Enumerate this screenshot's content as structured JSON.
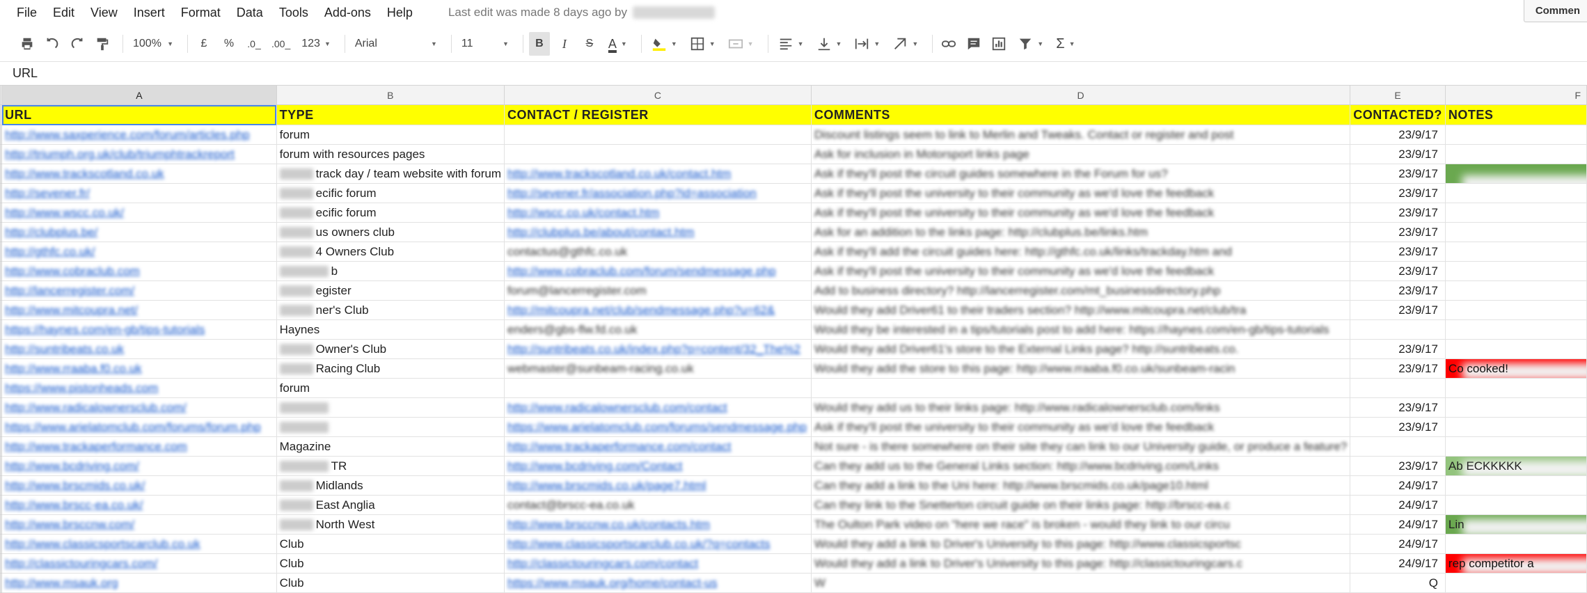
{
  "menu": {
    "items": [
      "File",
      "Edit",
      "View",
      "Insert",
      "Format",
      "Data",
      "Tools",
      "Add-ons",
      "Help"
    ],
    "last_edit": "Last edit was made 8 days ago by",
    "comments_label": "Commen"
  },
  "toolbar": {
    "zoom": "100%",
    "currency": "£",
    "percent": "%",
    "decrease_decimals": ".0_",
    "increase_decimals": ".00_",
    "more_formats": "123",
    "font": "Arial",
    "font_size": "11",
    "bold": "B",
    "italic": "I",
    "strikethrough": "S",
    "text_color": "A",
    "sigma": "Σ"
  },
  "formula_bar": {
    "value": "URL"
  },
  "columns": [
    "A",
    "B",
    "C",
    "D",
    "E",
    "F"
  ],
  "header_row": [
    "URL",
    "TYPE",
    "CONTACT / REGISTER",
    "COMMENTS",
    "CONTACTED?",
    "NOTES"
  ],
  "rows": [
    {
      "url": "http://www.saxperience.com/forum/articles.php",
      "type": "forum",
      "contact": "",
      "comments": "Discount listings seem to link to Merlin and Tweaks. Contact or register and post",
      "date": "23/9/17",
      "note": "",
      "note_style": ""
    },
    {
      "url": "http://triumph.org.uk/club/triumphtrackreport",
      "type": "forum with resources pages",
      "contact": "",
      "comments": "Ask for inclusion in Motorsport links page",
      "date": "23/9/17",
      "note": "",
      "note_style": ""
    },
    {
      "url": "http://www.trackscotland.co.uk",
      "type": "track day / team website with forum",
      "contact": "http://www.trackscotland.co.uk/contact.htm",
      "comments": "Ask if they'll post the circuit guides somewhere in the Forum for us?",
      "date": "23/9/17",
      "note": "",
      "note_style": "green"
    },
    {
      "url": "http://sevener.fr/",
      "type": "ecific forum",
      "contact": "http://sevener.fr/association.php?id=association",
      "comments": "Ask if they'll post the university to their community as we'd love the feedback",
      "date": "23/9/17",
      "note": "",
      "note_style": ""
    },
    {
      "url": "http://www.wscc.co.uk/",
      "type": "ecific forum",
      "contact": "http://wscc.co.uk/contact.htm",
      "comments": "Ask if they'll post the university to their community as we'd love the feedback",
      "date": "23/9/17",
      "note": "",
      "note_style": ""
    },
    {
      "url": "http://clubplus.be/",
      "type": "us owners club",
      "contact": "http://clubplus.be/about/contact.htm",
      "comments": "Ask for an addition to the links page: http://clubplus.be/links.htm",
      "date": "23/9/17",
      "note": "",
      "note_style": ""
    },
    {
      "url": "http://gthfc.co.uk/",
      "type": "4 Owners Club",
      "contact": "contactus@gthfc.co.uk",
      "comments": "Ask if they'll add the circuit guides here: http://gthfc.co.uk/links/trackday.htm and",
      "date": "23/9/17",
      "note": "",
      "note_style": ""
    },
    {
      "url": "http://www.cobraclub.com",
      "type": "b",
      "contact": "http://www.cobraclub.com/forum/sendmessage.php",
      "comments": "Ask if they'll post the university to their community as we'd love the feedback",
      "date": "23/9/17",
      "note": "",
      "note_style": ""
    },
    {
      "url": "http://lancerregister.com/",
      "type": "egister",
      "contact": "forum@lancerregister.com",
      "comments": "Add to business directory? http://lancerregister.com/mt_businessdirectory.php",
      "date": "23/9/17",
      "note": "",
      "note_style": ""
    },
    {
      "url": "http://www.mitcoupra.net/",
      "type": "ner's Club",
      "contact": "http://mitcoupra.net/club/sendmessage.php?u=62&",
      "comments": "Would they add Driver61 to their traders section? http://www.mitcoupra.net/club/tra",
      "date": "23/9/17",
      "note": "",
      "note_style": ""
    },
    {
      "url": "https://haynes.com/en-gb/tips-tutorials",
      "type": "Haynes",
      "contact": "enders@gbs-flw.fd.co.uk",
      "comments": "Would they be interested in a tips/tutorials post to add here: https://haynes.com/en-gb/tips-tutorials",
      "date": "",
      "note": "",
      "note_style": ""
    },
    {
      "url": "http://suntribeats.co.uk",
      "type": "Owner's Club",
      "contact": "http://suntribeats.co.uk/index.php?p=content/32_The%2",
      "comments": "Would they add Driver61's store to the External Links page? http://suntribeats.co.",
      "date": "23/9/17",
      "note": "",
      "note_style": ""
    },
    {
      "url": "http://www.rraaba.f0.co.uk",
      "type": "Racing Club",
      "contact": "webmaster@sunbeam-racing.co.uk",
      "comments": "Would they add the store to this page: http://www.rraaba.f0.co.uk/sunbeam-racin",
      "date": "23/9/17",
      "note": "Co             cooked!",
      "note_style": "red"
    },
    {
      "url": "https://www.pistonheads.com",
      "type": "forum",
      "contact": "",
      "comments": "",
      "date": "",
      "note": "",
      "note_style": ""
    },
    {
      "url": "http://www.radicalownersclub.com/",
      "type": "",
      "contact": "http://www.radicalownersclub.com/contact",
      "comments": "Would they add us to their links page: http://www.radicalownersclub.com/links",
      "date": "23/9/17",
      "note": "",
      "note_style": ""
    },
    {
      "url": "https://www.arielatomclub.com/forums/forum.php",
      "type": "",
      "contact": "https://www.arielatomclub.com/forums/sendmessage.php",
      "comments": "Ask if they'll post the university to their community as we'd love the feedback",
      "date": "23/9/17",
      "note": "",
      "note_style": ""
    },
    {
      "url": "http://www.trackaperformance.com",
      "type": "Magazine",
      "contact": "http://www.trackaperformance.com/contact",
      "comments": "Not sure - is there somewhere on their site they can link to our University guide, or produce a feature?",
      "date": "",
      "note": "",
      "note_style": ""
    },
    {
      "url": "http://www.bcdriving.com/",
      "type": "TR",
      "contact": "http://www.bcdriving.com/Contact",
      "comments": "Can they add us to the General Links section: http://www.bcdriving.com/Links",
      "date": "23/9/17",
      "note": "Ab                        ECKKKKK",
      "note_style": "lightgreen"
    },
    {
      "url": "http://www.brscmids.co.uk/",
      "type": "Midlands",
      "contact": "http://www.brscmids.co.uk/page7.html",
      "comments": "Can they add a link to the Uni here: http://www.brscmids.co.uk/page10.html",
      "date": "24/9/17",
      "note": "",
      "note_style": ""
    },
    {
      "url": "http://www.brscc-ea.co.uk/",
      "type": "East Anglia",
      "contact": "contact@brscc-ea.co.uk",
      "comments": "Can they link to the Snetterton circuit guide on their links page: http://brscc-ea.c",
      "date": "24/9/17",
      "note": "",
      "note_style": ""
    },
    {
      "url": "http://www.brsccnw.com/",
      "type": "North West",
      "contact": "http://www.brsccnw.co.uk/contacts.htm",
      "comments": "The Oulton Park video on \"here we race\" is broken - would they link to our circu",
      "date": "24/9/17",
      "note": "Lin",
      "note_style": "green"
    },
    {
      "url": "http://www.classicsportscarclub.co.uk",
      "type": "Club",
      "contact": "http://www.classicsportscarclub.co.uk/?q=contacts",
      "comments": "Would they add a link to Driver's University to this page: http://www.classicsportsc",
      "date": "24/9/17",
      "note": "",
      "note_style": ""
    },
    {
      "url": "http://classictouringcars.com/",
      "type": "Club",
      "contact": "http://classictouringcars.com/contact",
      "comments": "Would they add a link to Driver's University to this page: http://classictouringcars.c",
      "date": "24/9/17",
      "note": "rep                                     competitor a",
      "note_style": "red"
    },
    {
      "url": "http://www.msauk.org",
      "type": "Club",
      "contact": "https://www.msauk.org/home/contact-us",
      "comments": "W",
      "date": "Q",
      "note": "",
      "note_style": ""
    }
  ],
  "blurred_prefix_rows": [
    2,
    3,
    4,
    5,
    6,
    7,
    8,
    9,
    11,
    12,
    14,
    15,
    17,
    18,
    19,
    20
  ]
}
